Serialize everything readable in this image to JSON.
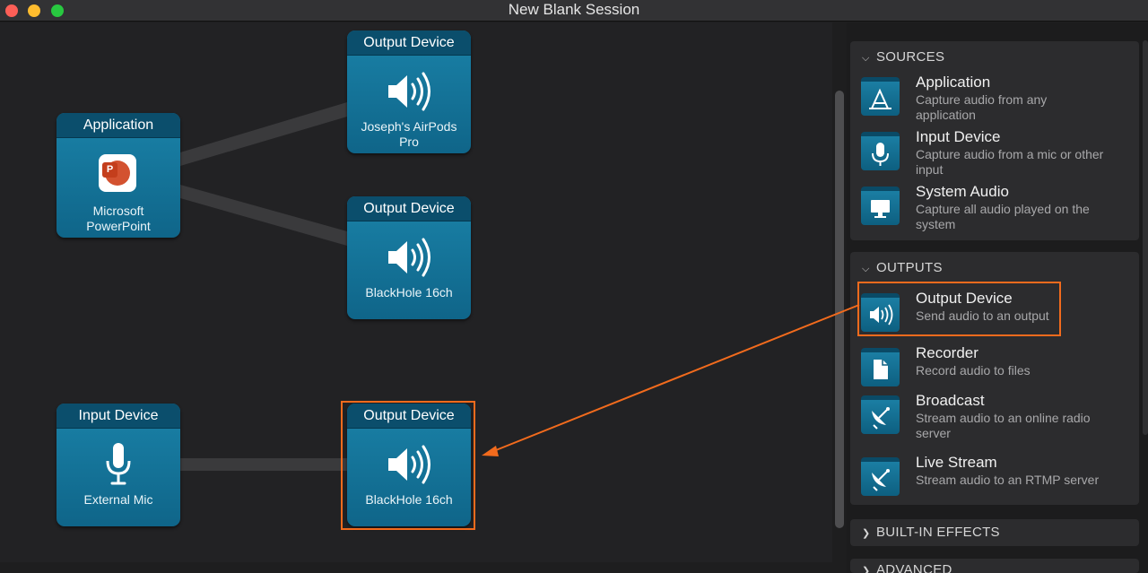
{
  "window": {
    "title": "New Blank Session"
  },
  "canvas": {
    "nodes": {
      "app": {
        "header": "Application",
        "label_line1": "Microsoft",
        "label_line2": "PowerPoint",
        "icon_letter": "P"
      },
      "out1": {
        "header": "Output Device",
        "label_line1": "Joseph's AirPods",
        "label_line2": "Pro"
      },
      "out2": {
        "header": "Output Device",
        "label_line1": "BlackHole 16ch"
      },
      "mic": {
        "header": "Input Device",
        "label_line1": "External Mic"
      },
      "out3": {
        "header": "Output Device",
        "label_line1": "BlackHole 16ch"
      }
    }
  },
  "sidebar": {
    "sources": {
      "title": "SOURCES",
      "items": [
        {
          "name": "Application",
          "desc_line1": "Capture audio from any",
          "desc_line2": "application",
          "icon": "app-store-icon"
        },
        {
          "name": "Input Device",
          "desc_line1": "Capture audio from a mic or other",
          "desc_line2": "input",
          "icon": "microphone-icon"
        },
        {
          "name": "System Audio",
          "desc_line1": "Capture all audio played on the",
          "desc_line2": "system",
          "icon": "monitor-icon"
        }
      ]
    },
    "outputs": {
      "title": "OUTPUTS",
      "items": [
        {
          "name": "Output Device",
          "desc_line1": "Send audio to an output",
          "icon": "speaker-icon"
        },
        {
          "name": "Recorder",
          "desc_line1": "Record audio to files",
          "icon": "document-icon"
        },
        {
          "name": "Broadcast",
          "desc_line1": "Stream audio to an online radio",
          "desc_line2": "server",
          "icon": "satellite-dish-icon"
        },
        {
          "name": "Live Stream",
          "desc_line1": "Stream audio to an RTMP server",
          "icon": "satellite-dish-icon"
        }
      ]
    },
    "builtin_effects": {
      "title": "BUILT-IN EFFECTS"
    },
    "advanced": {
      "title": "ADVANCED"
    }
  },
  "colors": {
    "node_blue": "#1a82a8",
    "node_header": "#0b4e6c",
    "highlight_orange": "#f26b1d"
  }
}
